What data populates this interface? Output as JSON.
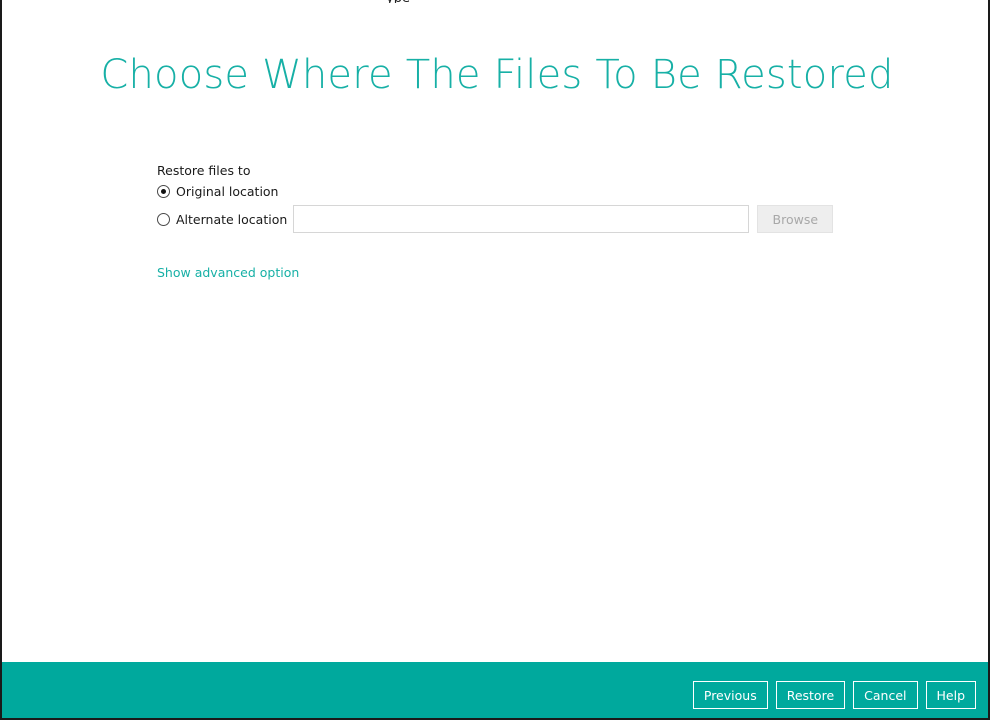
{
  "header": {
    "top_fragment": "ype",
    "title": "Choose Where The Files To Be Restored"
  },
  "restore": {
    "section_label": "Restore files to",
    "options": [
      {
        "label": "Original location",
        "selected": true
      },
      {
        "label": "Alternate location",
        "selected": false
      }
    ],
    "alternate_path_value": "",
    "browse_label": "Browse",
    "advanced_link": "Show advanced option"
  },
  "footer": {
    "previous_label": "Previous",
    "restore_label": "Restore",
    "cancel_label": "Cancel",
    "help_label": "Help"
  },
  "colors": {
    "accent": "#17b0a6",
    "footer_bg": "#00a99d"
  }
}
